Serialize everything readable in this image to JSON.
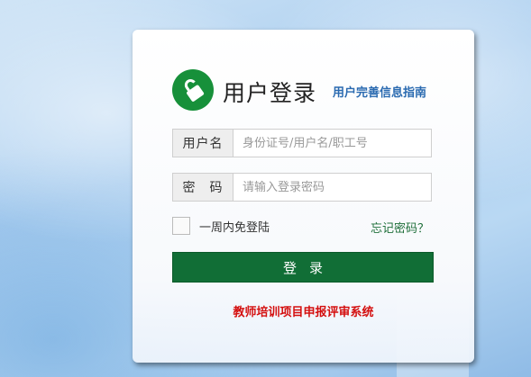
{
  "login": {
    "title": "用户登录",
    "guide_link": "用户完善信息指南",
    "username_label": "用户名",
    "username_placeholder": "身份证号/用户名/职工号",
    "password_label": "密　码",
    "password_placeholder": "请输入登录密码",
    "remember_label": "一周内免登陆",
    "forgot_link": "忘记密码？",
    "submit_label": "登录",
    "system_name": "教师培训项目申报评审系统"
  },
  "colors": {
    "brand_green": "#116e36",
    "logo_green": "#17903a",
    "link_blue": "#2a6ab0",
    "system_red": "#d40e0e"
  },
  "icons": {
    "logo": "lock-icon"
  }
}
